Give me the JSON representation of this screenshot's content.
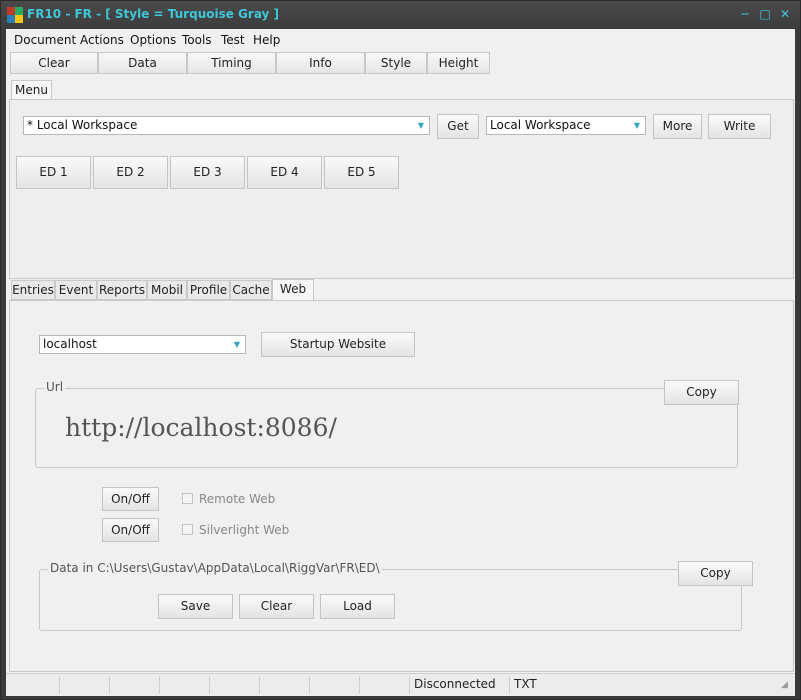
{
  "window": {
    "title": "FR10 - FR - [ Style = Turquoise Gray ]",
    "minimize": "─",
    "maximize": "□",
    "close": "✕"
  },
  "menubar": [
    "Document",
    "Actions",
    "Options",
    "Tools",
    "Test",
    "Help"
  ],
  "toolbar": [
    "Clear",
    "Data",
    "Timing",
    "Info",
    "Style",
    "Height"
  ],
  "top_tab": "Menu",
  "workspace": {
    "combo1_value": "* Local Workspace",
    "get_label": "Get",
    "combo2_value": "Local Workspace",
    "more_label": "More",
    "write_label": "Write"
  },
  "ed_buttons": [
    "ED 1",
    "ED 2",
    "ED 3",
    "ED 4",
    "ED 5"
  ],
  "lower_tabs": [
    "Entries",
    "Event",
    "Reports",
    "Mobil",
    "Profile",
    "Cache",
    "Web"
  ],
  "active_lower_tab": "Web",
  "web": {
    "host_value": "localhost",
    "startup_label": "Startup Website",
    "url_legend": "Url",
    "url_copy_label": "Copy",
    "url_text": "http://localhost:8086/",
    "onoff1_label": "On/Off",
    "onoff2_label": "On/Off",
    "remote_web_label": "Remote Web",
    "silverlight_web_label": "Silverlight Web",
    "data_legend": "Data in C:\\Users\\Gustav\\AppData\\Local\\RiggVar\\FR\\ED\\",
    "data_copy_label": "Copy",
    "save_label": "Save",
    "clear_label": "Clear",
    "load_label": "Load"
  },
  "status": {
    "connection": "Disconnected",
    "format": "TXT"
  },
  "colors": {
    "accent": "#3ec7d9",
    "frame": "#3a3a3a",
    "client": "#f0f0f0"
  }
}
